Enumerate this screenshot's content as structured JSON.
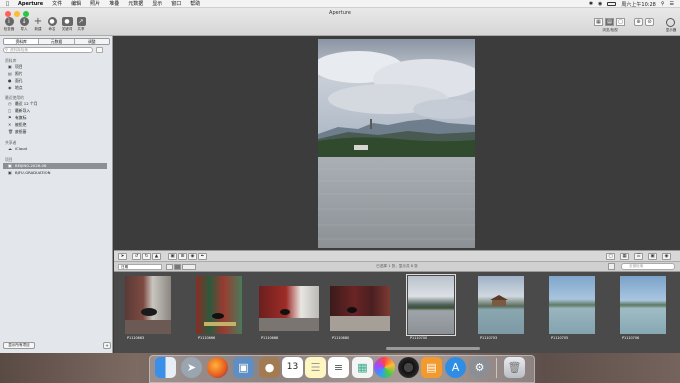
{
  "menubar": {
    "apple_icon": "apple-icon",
    "app": "Aperture",
    "items": [
      "文件",
      "编辑",
      "照片",
      "堆叠",
      "元数据",
      "显示",
      "窗口",
      "帮助"
    ],
    "clock": "周六上午10:28"
  },
  "window": {
    "title": "Aperture"
  },
  "toolbar": {
    "buttons": [
      "检查器",
      "导入",
      "新建",
      "命名",
      "关键词",
      "共享"
    ],
    "layout_label": "浏览/检视",
    "adjust_label": "调整",
    "search_label": "显示器"
  },
  "sidebar": {
    "tabs": [
      "资料库",
      "元数据",
      "调整"
    ],
    "search_placeholder": "资料库检索",
    "section_library": "资料库",
    "library_items": [
      {
        "icon": "projects-icon",
        "label": "项目"
      },
      {
        "icon": "photos-icon",
        "label": "照片"
      },
      {
        "icon": "faces-icon",
        "label": "面孔"
      },
      {
        "icon": "places-icon",
        "label": "地点"
      }
    ],
    "section_recent": "最近使用的",
    "recent_items": [
      {
        "icon": "clock-icon",
        "label": "最近 12 个月"
      },
      {
        "icon": "import-icon",
        "label": "最新导入"
      },
      {
        "icon": "flag-icon",
        "label": "有旗标"
      },
      {
        "icon": "reject-icon",
        "label": "被拒绝"
      },
      {
        "icon": "trash-icon",
        "label": "废纸篓"
      }
    ],
    "section_shared": "共享者",
    "shared_items": [
      {
        "icon": "cloud-icon",
        "label": "iCloud"
      }
    ],
    "section_projects": "项目",
    "project_items": [
      {
        "icon": "project-icon",
        "label": "BEIJING-2026-08",
        "selected": true
      },
      {
        "icon": "project-icon",
        "label": "BJFU-GRADUATION",
        "selected": false
      }
    ],
    "bottom_button": "显示所有项目",
    "bottom_action": "+"
  },
  "statusbar": {
    "sort": "日期",
    "text": "已选择 1 张，显示共 8 张",
    "search_placeholder": "全部检索"
  },
  "filmstrip": {
    "thumbs": [
      {
        "caption": "P1110663",
        "selected": false
      },
      {
        "caption": "P1110666",
        "selected": false
      },
      {
        "caption": "P1110668",
        "selected": false
      },
      {
        "caption": "P1110680",
        "selected": false
      },
      {
        "caption": "P1110700",
        "selected": true
      },
      {
        "caption": "P1110703",
        "selected": false
      },
      {
        "caption": "P1110705",
        "selected": false
      },
      {
        "caption": "P1110706",
        "selected": false
      }
    ]
  },
  "dock": {
    "apps": [
      "finder",
      "launchpad",
      "firefox",
      "preview",
      "contacts",
      "calendar",
      "notes",
      "reminders",
      "photos",
      "aperture",
      "books",
      "app-store",
      "system-preferences",
      "trash"
    ],
    "calendar_day": "13"
  }
}
